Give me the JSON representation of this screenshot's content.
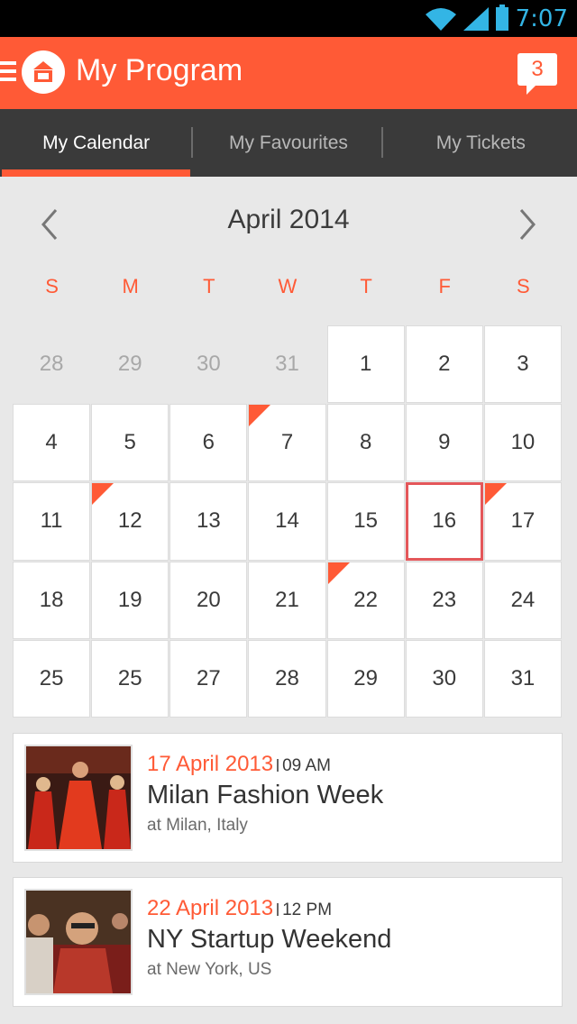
{
  "status_bar": {
    "time": "7:07"
  },
  "header": {
    "title": "My Program",
    "notifications": "3"
  },
  "tabs": [
    {
      "label": "My Calendar"
    },
    {
      "label": "My Favourites"
    },
    {
      "label": "My Tickets"
    }
  ],
  "calendar": {
    "month": "April 2014",
    "weekdays": [
      "S",
      "M",
      "T",
      "W",
      "T",
      "F",
      "S"
    ],
    "days": [
      {
        "label": "28",
        "muted": true
      },
      {
        "label": "29",
        "muted": true
      },
      {
        "label": "30",
        "muted": true
      },
      {
        "label": "31",
        "muted": true
      },
      {
        "label": "1"
      },
      {
        "label": "2"
      },
      {
        "label": "3"
      },
      {
        "label": "4"
      },
      {
        "label": "5"
      },
      {
        "label": "6"
      },
      {
        "label": "7",
        "event": true
      },
      {
        "label": "8"
      },
      {
        "label": "9"
      },
      {
        "label": "10"
      },
      {
        "label": "11"
      },
      {
        "label": "12",
        "event": true
      },
      {
        "label": "13"
      },
      {
        "label": "14"
      },
      {
        "label": "15"
      },
      {
        "label": "16",
        "today": true
      },
      {
        "label": "17",
        "event": true
      },
      {
        "label": "18"
      },
      {
        "label": "19"
      },
      {
        "label": "20"
      },
      {
        "label": "21"
      },
      {
        "label": "22",
        "event": true
      },
      {
        "label": "23"
      },
      {
        "label": "24"
      },
      {
        "label": "25"
      },
      {
        "label": "25"
      },
      {
        "label": "27"
      },
      {
        "label": "28"
      },
      {
        "label": "29"
      },
      {
        "label": "30"
      },
      {
        "label": "31"
      }
    ]
  },
  "events": [
    {
      "date": "17 April 2013",
      "time": "09 AM",
      "name": "Milan Fashion Week",
      "location": "at Milan, Italy"
    },
    {
      "date": "22 April 2013",
      "time": "12 PM",
      "name": "NY Startup Weekend",
      "location": "at New York, US"
    }
  ],
  "colors": {
    "accent": "#ff5a36",
    "tab_bar": "#3a3a3a",
    "status": "#33b5e5"
  }
}
